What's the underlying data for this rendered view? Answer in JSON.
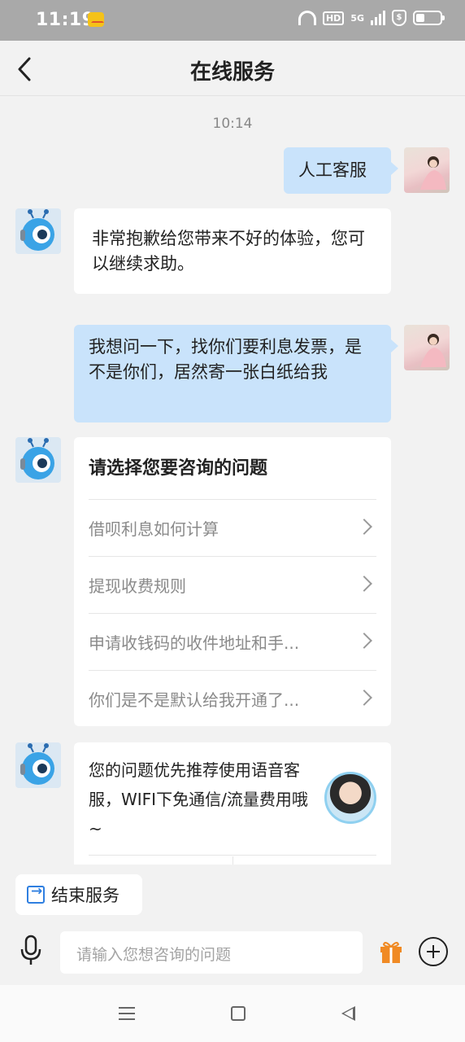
{
  "status_bar": {
    "time": "11:19",
    "icons": [
      "mail-notification-icon",
      "wifi-icon",
      "hd-icon",
      "5g-signal-icon",
      "shield-icon",
      "battery-icon"
    ],
    "hd_label": "HD",
    "network_label": "5G",
    "shield_label": "$"
  },
  "header": {
    "title": "在线服务",
    "back_icon": "chevron-left-icon"
  },
  "chat": {
    "timestamp": "10:14",
    "messages": [
      {
        "sender": "user",
        "text": "人工客服"
      },
      {
        "sender": "bot",
        "text": "非常抱歉给您带来不好的体验，您可以继续求助。"
      },
      {
        "sender": "user",
        "text": "我想问一下，找你们要利息发票，是不是你们，居然寄一张白纸给我"
      }
    ],
    "menu_card": {
      "title": "请选择您要咨询的问题",
      "items": [
        "借呗利息如何计算",
        "提现收费规则",
        "申请收钱码的收件地址和手...",
        "你们是不是默认给我开通了..."
      ]
    },
    "voice_card": {
      "text": "您的问题优先推荐使用语音客服，WIFI下免通信/流量费用哦~"
    }
  },
  "actions": {
    "end_service_label": "结束服务"
  },
  "input_bar": {
    "placeholder": "请输入您想咨询的问题",
    "icons": [
      "microphone-icon",
      "gift-icon",
      "plus-icon"
    ]
  },
  "colors": {
    "user_bubble": "#c9e3fb",
    "accent_blue": "#2f7fe0",
    "gift_orange": "#f08a24"
  }
}
